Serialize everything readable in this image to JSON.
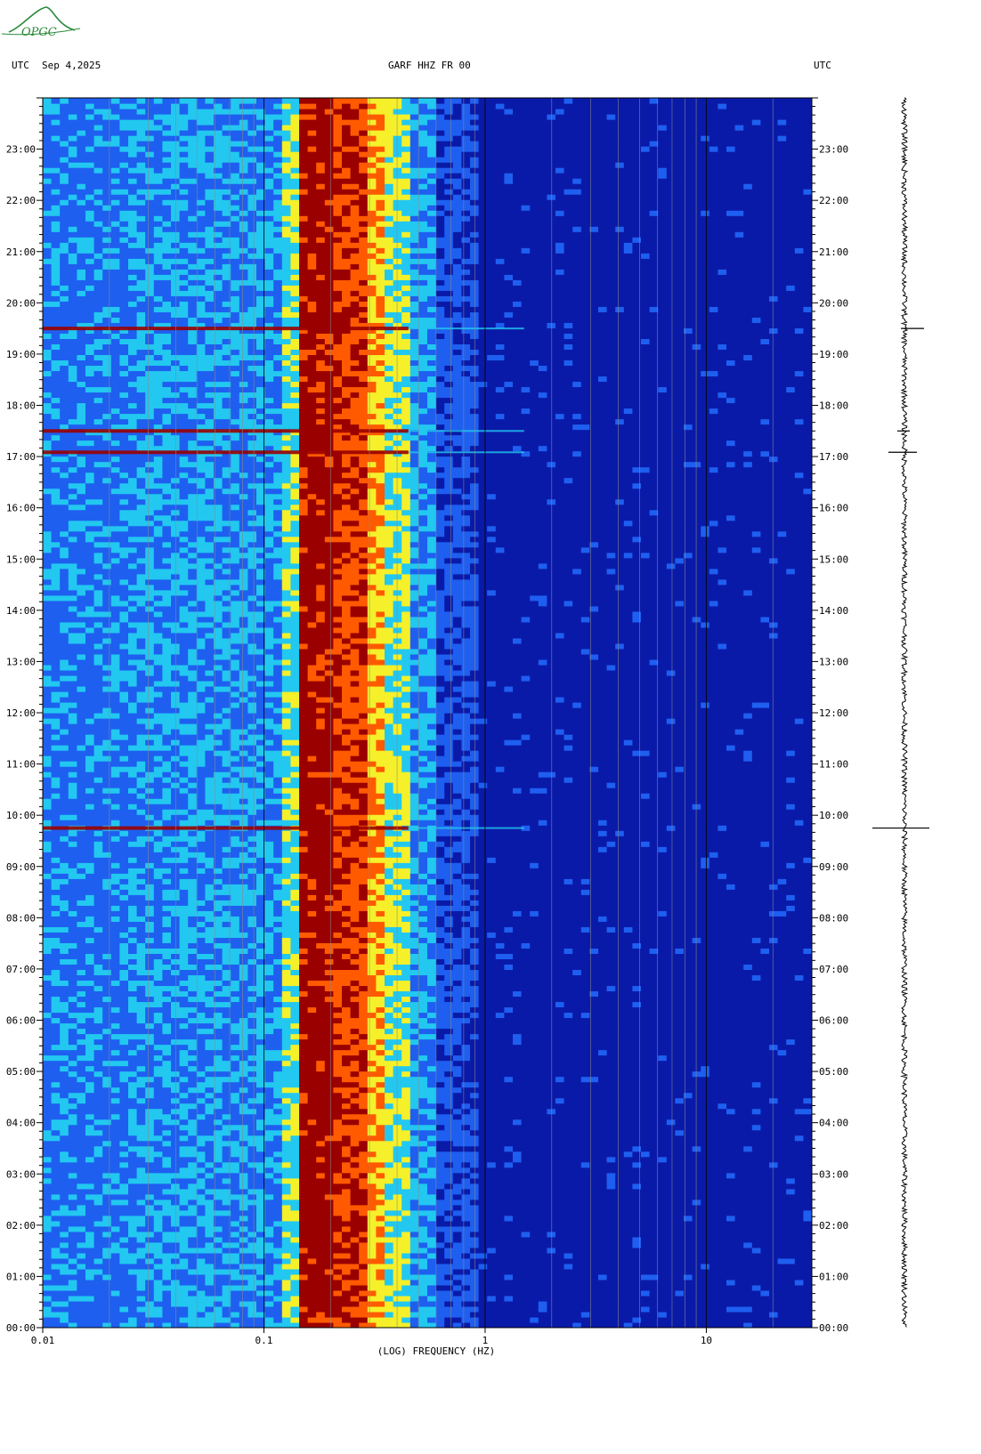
{
  "header": {
    "left_tz": "UTC",
    "date": "Sep 4,2025",
    "station": "GARF HHZ FR 00",
    "right_tz": "UTC"
  },
  "logo": {
    "text": "OPGC",
    "color": "#2a8a3a"
  },
  "colors": {
    "low": "#0a1aa8",
    "mid_low": "#1e5ff0",
    "cyan": "#22c8f0",
    "yellow": "#f5f02a",
    "orange": "#ff5a00",
    "high": "#9a0000",
    "trace": "#000000"
  },
  "chart_data": {
    "type": "heatmap",
    "xlabel": "(LOG) FREQUENCY (HZ)",
    "x_scale": "log",
    "xlim": [
      0.01,
      30
    ],
    "x_ticks": [
      "0.01",
      "0.1",
      "1",
      "10"
    ],
    "y_ticks": [
      "00:00",
      "01:00",
      "02:00",
      "03:00",
      "04:00",
      "05:00",
      "06:00",
      "07:00",
      "08:00",
      "09:00",
      "10:00",
      "11:00",
      "12:00",
      "13:00",
      "14:00",
      "15:00",
      "16:00",
      "17:00",
      "18:00",
      "19:00",
      "20:00",
      "21:00",
      "22:00",
      "23:00"
    ],
    "ylim_hours": [
      0,
      24
    ],
    "dominant_band_hz": [
      0.14,
      0.3
    ],
    "events": [
      {
        "time": "17:05",
        "note": ""
      },
      {
        "time": "17:30",
        "note": ""
      },
      {
        "time": "19:30",
        "note": ""
      },
      {
        "time": "09:45",
        "note": ""
      }
    ]
  }
}
